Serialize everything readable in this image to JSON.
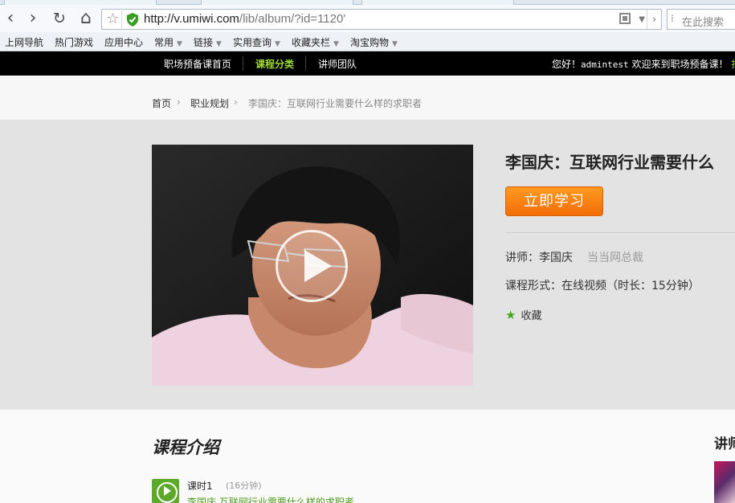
{
  "browser": {
    "url_host": "http://v.umiwi.com",
    "url_path": "/lib/album/?id=1120'",
    "search_placeholder": "在此搜索",
    "bookmarks": [
      {
        "label": "上网导航",
        "has_menu": false
      },
      {
        "label": "热门游戏",
        "has_menu": false
      },
      {
        "label": "应用中心",
        "has_menu": false
      },
      {
        "label": "常用",
        "has_menu": true
      },
      {
        "label": "链接",
        "has_menu": true
      },
      {
        "label": "实用查询",
        "has_menu": true
      },
      {
        "label": "收藏夹栏",
        "has_menu": true
      },
      {
        "label": "淘宝购物",
        "has_menu": true
      }
    ]
  },
  "site_nav": {
    "links": [
      "职场预备课首页",
      "课程分类",
      "讲师团队"
    ],
    "active": "课程分类",
    "greeting_prefix": "您好！",
    "username": "admintest",
    "greeting_suffix": "欢迎来到职场预备课！",
    "greeting_cut": "找"
  },
  "breadcrumb": {
    "home": "首页",
    "category": "职业规划",
    "current": "李国庆：互联网行业需要什么样的求职者"
  },
  "course": {
    "title": "李国庆：互联网行业需要什么",
    "study_button": "立即学习",
    "teacher_label": "讲师：李国庆",
    "teacher_title": "当当网总裁",
    "format": "课程形式：在线视频（时长：15分钟）",
    "favorite": "收藏"
  },
  "intro": {
    "title": "课程介绍",
    "lesson_label": "课时1",
    "lesson_duration": "(16分钟)",
    "lesson_link": "李国庆 互联网行业需要什么样的求职者",
    "side_title": "讲师"
  }
}
